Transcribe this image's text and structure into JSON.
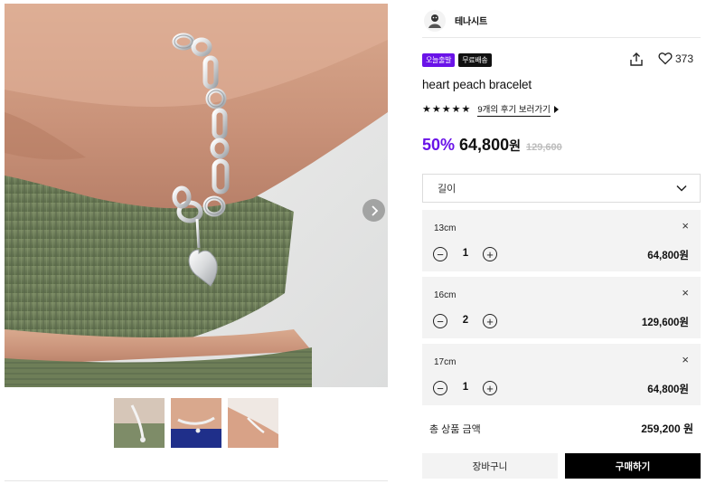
{
  "brand": {
    "name": "테나시트"
  },
  "badges": [
    "오늘출발",
    "무료배송"
  ],
  "like_count": "373",
  "product": {
    "name": "heart peach bracelet",
    "review_link": "9개의 후기 보러가기",
    "rating": 5,
    "discount": "50%",
    "sale_price": "64,800",
    "currency": "원",
    "original_price": "129,600"
  },
  "option_select": {
    "label": "길이"
  },
  "options": [
    {
      "name": "13cm",
      "qty": "1",
      "price": "64,800원",
      "remove": "×"
    },
    {
      "name": "16cm",
      "qty": "2",
      "price": "129,600원",
      "remove": "×"
    },
    {
      "name": "17cm",
      "qty": "1",
      "price": "64,800원",
      "remove": "×"
    }
  ],
  "total": {
    "label": "총 상품 금액",
    "amount": "259,200 원"
  },
  "buttons": {
    "cart": "장바구니",
    "buy": "구매하기"
  },
  "colors": {
    "accent": "#6a13e8",
    "black": "#000000",
    "panel": "#f3f3f3"
  },
  "icons": [
    "chevron-right-icon",
    "share-icon",
    "heart-icon",
    "chevron-down-icon",
    "close-icon",
    "minus-circle-icon",
    "plus-circle-icon",
    "star-icon"
  ]
}
